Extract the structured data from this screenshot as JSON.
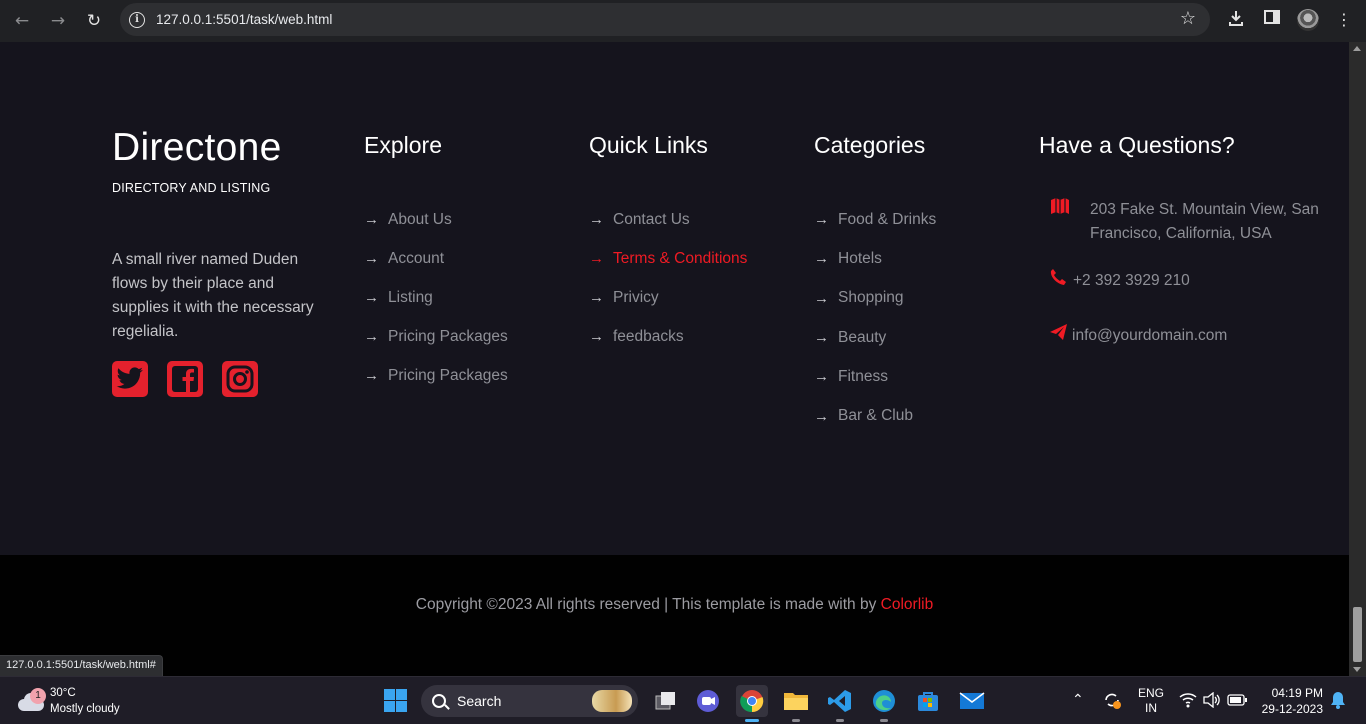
{
  "browser": {
    "url": "127.0.0.1:5501/task/web.html",
    "status_url": "127.0.0.1:5501/task/web.html#"
  },
  "brand": {
    "name": "Directone",
    "tagline": "DIRECTORY AND LISTING",
    "about": "A small river named Duden flows by their place and supplies it with the necessary regelialia."
  },
  "socials": [
    "twitter-icon",
    "facebook-icon",
    "instagram-icon"
  ],
  "explore": {
    "title": "Explore",
    "items": [
      "About Us",
      "Account",
      "Listing",
      "Pricing Packages",
      "Pricing Packages"
    ]
  },
  "quick_links": {
    "title": "Quick Links",
    "items": [
      "Contact Us",
      "Terms & Conditions",
      "Privicy",
      "feedbacks"
    ],
    "active_index": 1
  },
  "categories": {
    "title": "Categories",
    "items": [
      "Food & Drinks",
      "Hotels",
      "Shopping",
      "Beauty",
      "Fitness",
      "Bar & Club"
    ]
  },
  "questions": {
    "title": "Have a Questions?",
    "address": "203 Fake St. Mountain View, San Francisco, California, USA",
    "phone": "+2 392 3929 210",
    "email": "info@yourdomain.com"
  },
  "copyright": {
    "text": "Copyright ©2023 All rights reserved | This template is made with by ",
    "brand": "Colorlib"
  },
  "colors": {
    "accent": "#ef1b24",
    "page_bg": "#15141d",
    "bottom_bg": "#010101"
  },
  "taskbar": {
    "weather_temp": "30°C",
    "weather_desc": "Mostly cloudy",
    "weather_badge": "1",
    "search": "Search",
    "lang": "ENG",
    "region": "IN",
    "time": "04:19 PM",
    "date": "29-12-2023"
  }
}
